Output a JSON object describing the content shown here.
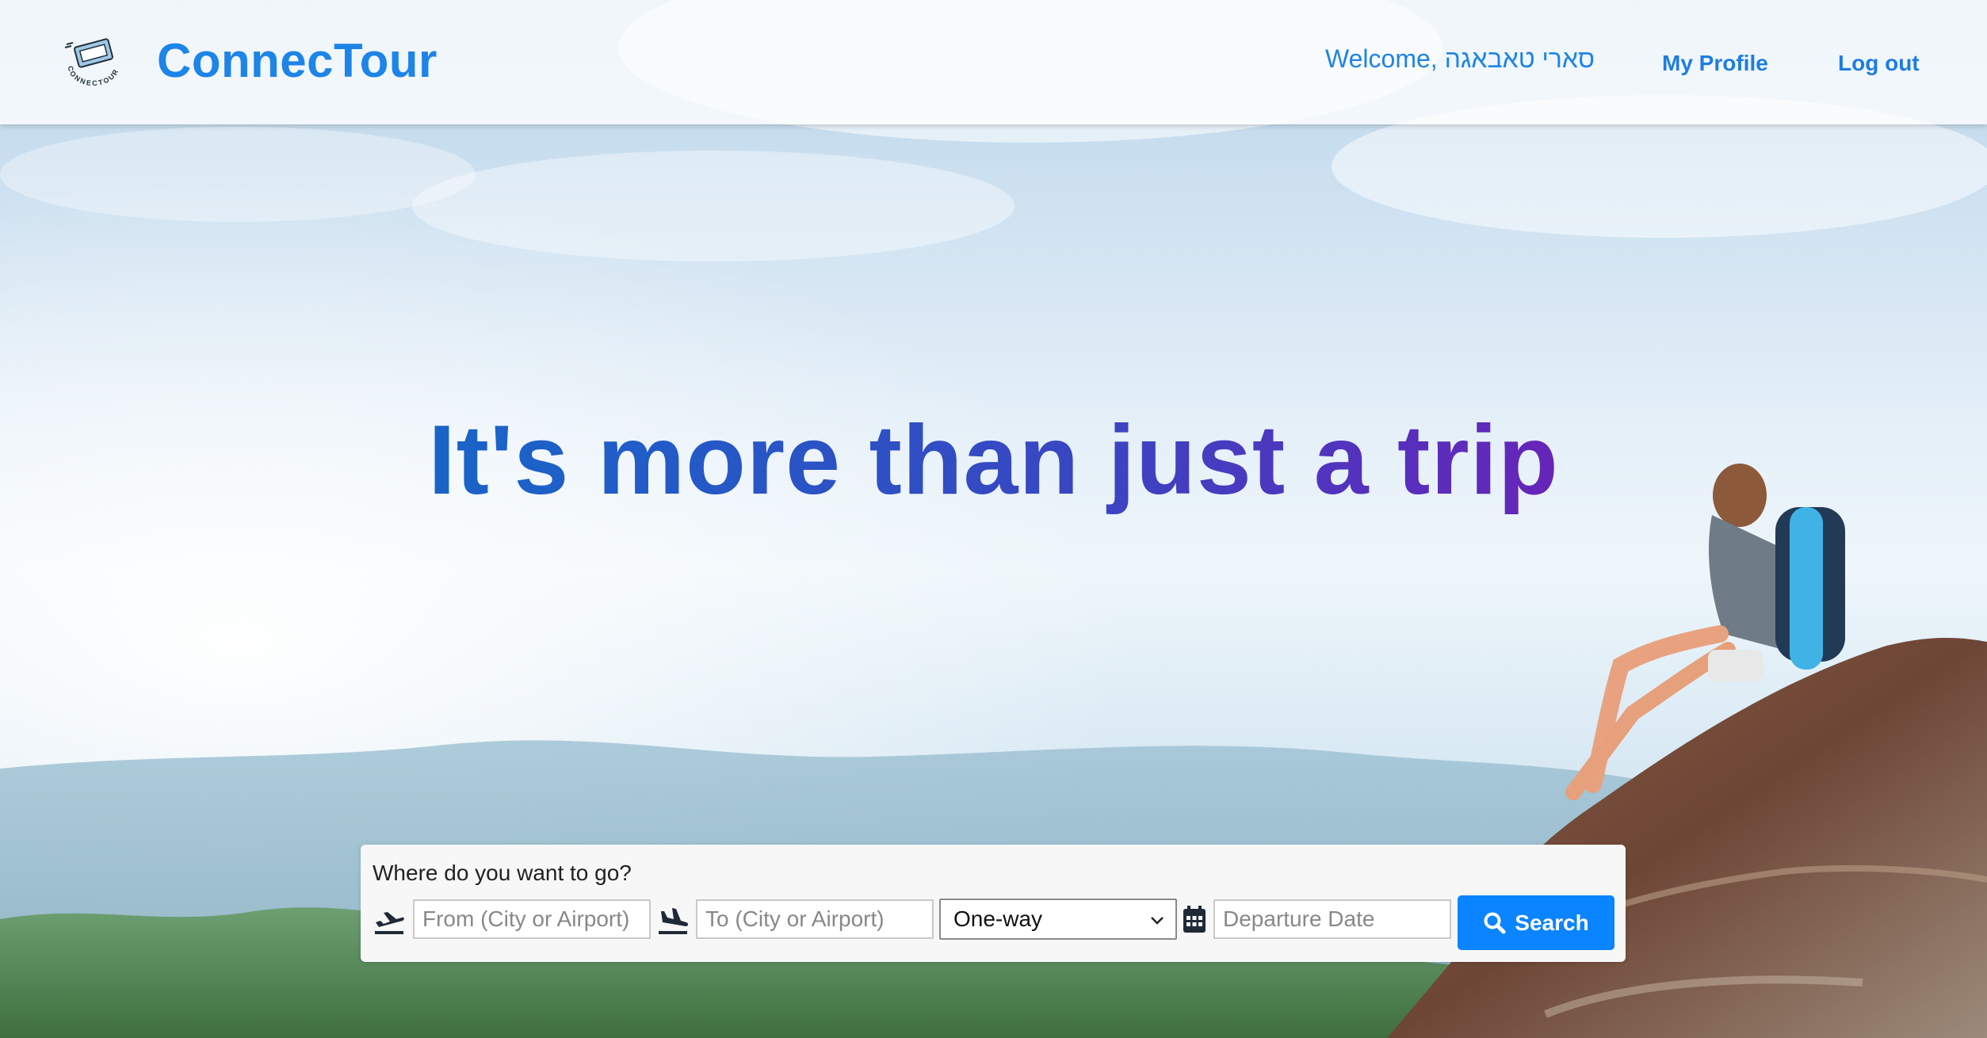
{
  "header": {
    "logo_text": "CONNECTOUR",
    "brand": "ConnecTour",
    "welcome": "Welcome, סארי טאבאגה",
    "my_profile": "My Profile",
    "log_out": "Log out",
    "brand_color": "#1d84e8"
  },
  "hero": {
    "headline": "It's more than just a trip",
    "gradient_start": "#0a74c4",
    "gradient_end": "#7615b0"
  },
  "search": {
    "title": "Where do you want to go?",
    "from_placeholder": "From (City or Airport)",
    "to_placeholder": "To (City or Airport)",
    "trip_type": "One-way",
    "date_placeholder": "Departure Date",
    "button_label": "Search",
    "button_color": "#0a84ff",
    "icons": {
      "from": "plane-takeoff-icon",
      "to": "plane-landing-icon",
      "date": "calendar-icon",
      "button": "search-icon"
    }
  }
}
